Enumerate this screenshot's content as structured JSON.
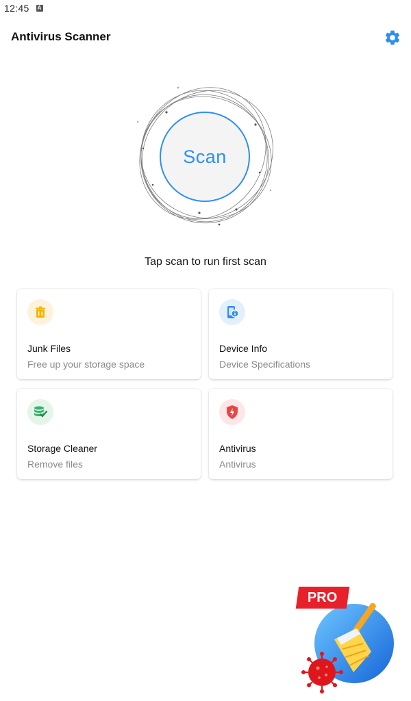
{
  "status_bar": {
    "time": "12:45",
    "notification": "A"
  },
  "app_bar": {
    "title": "Antivirus Scanner",
    "settings_icon": "gear-icon"
  },
  "scan": {
    "button_label": "Scan",
    "hint": "Tap scan to run first scan"
  },
  "colors": {
    "accent": "#2e8ef0"
  },
  "cards": [
    {
      "title": "Junk Files",
      "subtitle": "Free up your storage space",
      "icon": "trash-icon",
      "icon_bg": "#fdf3dc",
      "icon_color": "#f4b400"
    },
    {
      "title": "Device Info",
      "subtitle": "Device Specifications",
      "icon": "phone-info-icon",
      "icon_bg": "#e3f0fc",
      "icon_color": "#2e8ef0"
    },
    {
      "title": "Storage Cleaner",
      "subtitle": "Remove files",
      "icon": "database-check-icon",
      "icon_bg": "#e4f5ea",
      "icon_color": "#34b36b"
    },
    {
      "title": "Antivirus",
      "subtitle": "Antivirus",
      "icon": "shield-bolt-icon",
      "icon_bg": "#fde6e6",
      "icon_color": "#e84545"
    }
  ],
  "promo": {
    "label": "PRO",
    "icon": "broom-virus-icon"
  }
}
